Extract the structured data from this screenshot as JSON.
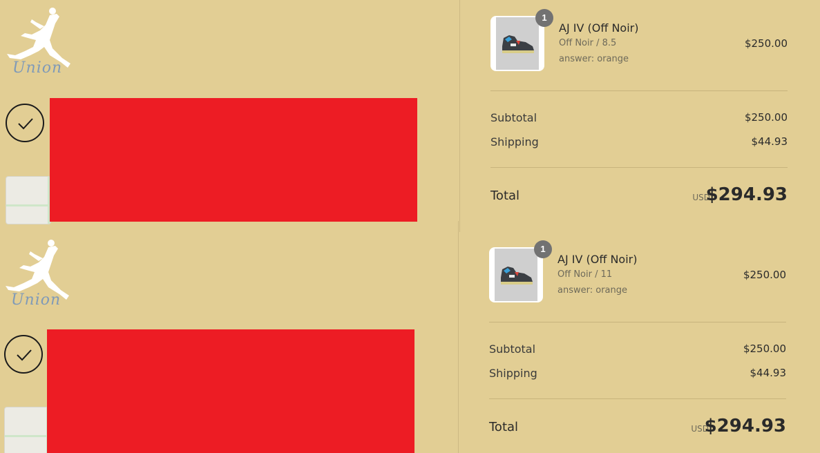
{
  "screens": [
    {
      "logo": {
        "script_text": "Union"
      },
      "order_item": {
        "quantity": "1",
        "name": "AJ IV (Off Noir)",
        "variant": "Off Noir / 8.5",
        "answer": "answer: orange",
        "price": "$250.00"
      },
      "summary": {
        "subtotal_label": "Subtotal",
        "subtotal_value": "$250.00",
        "shipping_label": "Shipping",
        "shipping_value": "$44.93",
        "total_label": "Total",
        "currency": "USD",
        "total_value": "$294.93"
      }
    },
    {
      "logo": {
        "script_text": "Union"
      },
      "order_item": {
        "quantity": "1",
        "name": "AJ IV (Off Noir)",
        "variant": "Off Noir / 11",
        "answer": "answer: orange",
        "price": "$250.00"
      },
      "summary": {
        "subtotal_label": "Subtotal",
        "subtotal_value": "$250.00",
        "shipping_label": "Shipping",
        "shipping_value": "$44.93",
        "total_label": "Total",
        "currency": "USD",
        "total_value": "$294.93"
      }
    }
  ],
  "colors": {
    "page_background": "#e2ce94",
    "redaction": "#ed1c24",
    "badge": "#727272"
  },
  "icons": [
    "jumpman-logo-icon",
    "checkmark-icon",
    "map-thumbnail",
    "shoe-product-image"
  ]
}
